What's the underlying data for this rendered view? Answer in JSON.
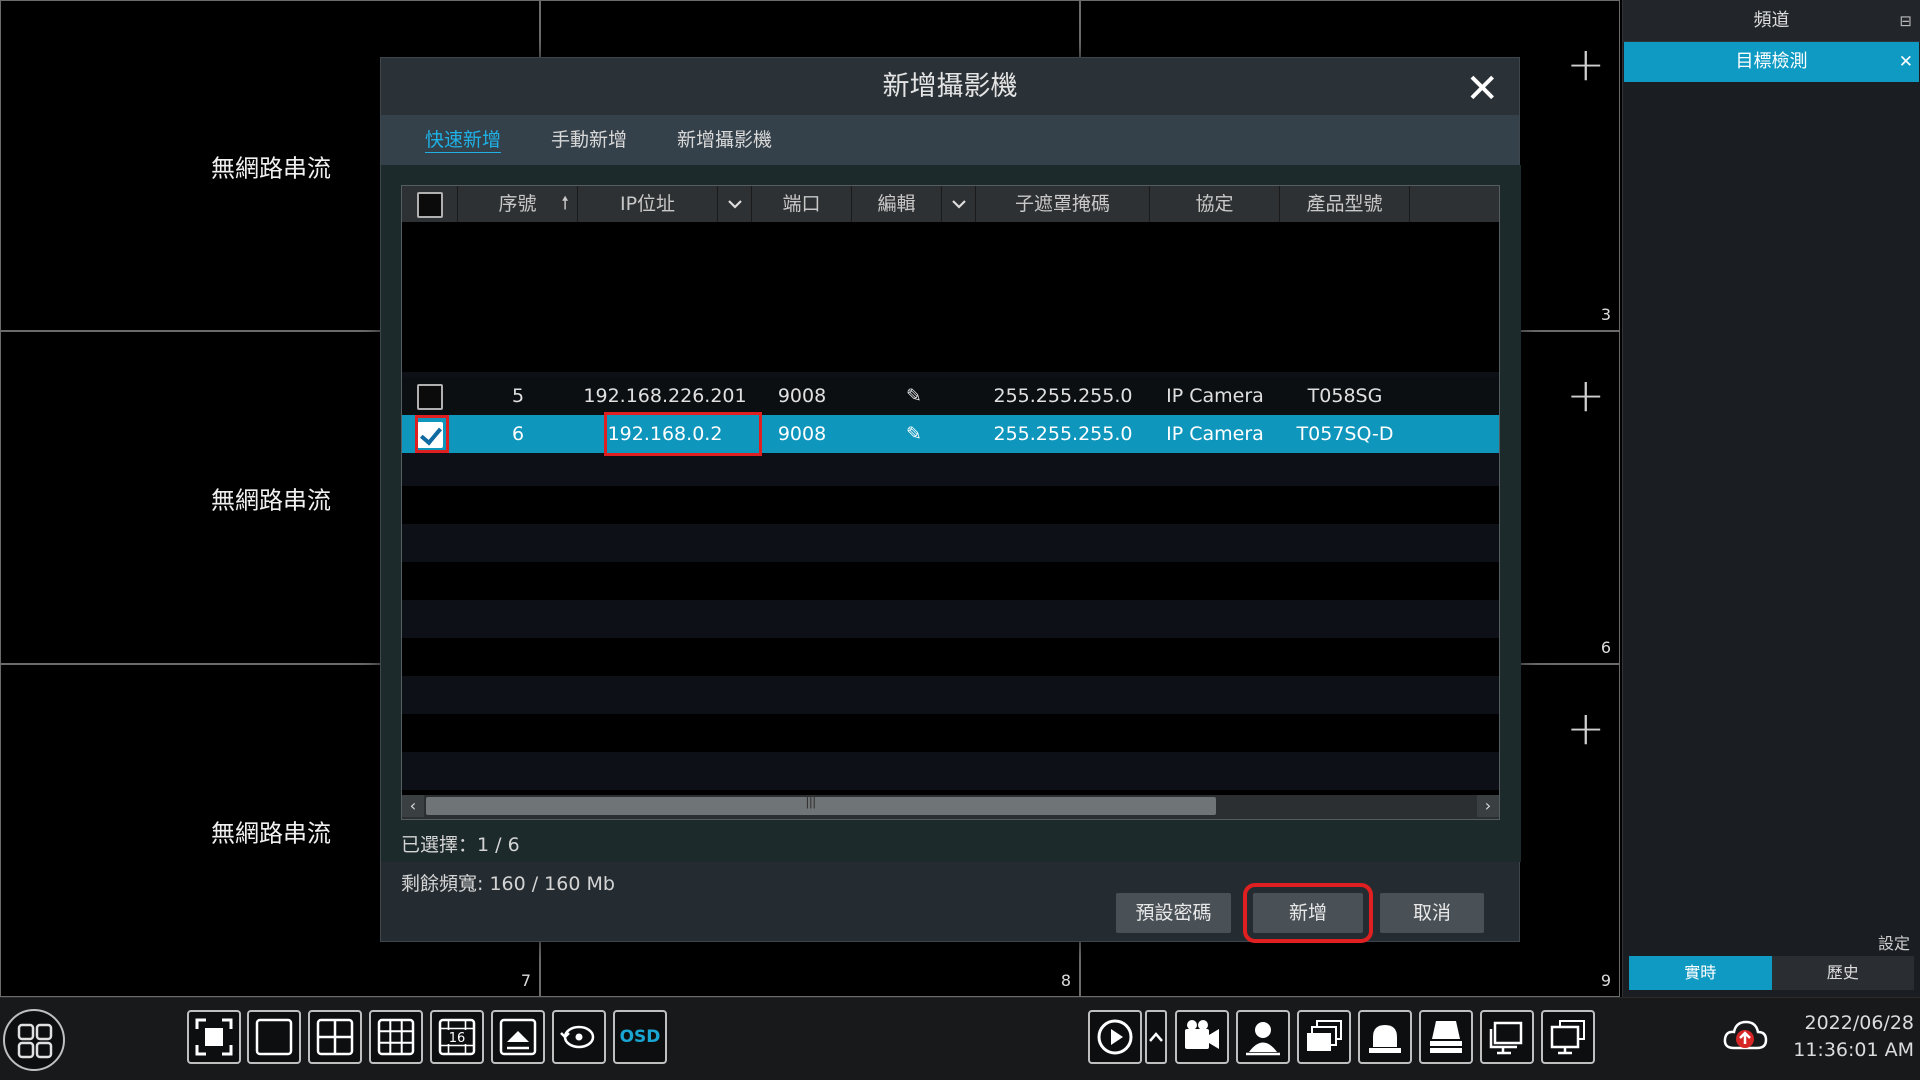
{
  "grid": {
    "no_stream_text": "無網路串流",
    "cell_numbers": [
      "3",
      "6",
      "7",
      "8",
      "9"
    ],
    "add_icon": "plus-icon"
  },
  "side_panel": {
    "header": "頻道",
    "pin_icon": "pin-icon",
    "active_tab": "目標檢測",
    "settings_label": "設定",
    "mode_live": "實時",
    "mode_history": "歷史"
  },
  "dialog": {
    "title": "新增攝影機",
    "tabs": [
      "快速新增",
      "手動新增",
      "新增攝影機"
    ],
    "active_tab_index": 0,
    "columns": [
      "序號",
      "IP位址",
      "端口",
      "編輯",
      "子遮罩掩碼",
      "協定",
      "產品型號"
    ],
    "rows": [
      {
        "checked": false,
        "index": "5",
        "ip": "192.168.226.201",
        "port": "9008",
        "mask": "255.255.255.0",
        "protocol": "IP Camera",
        "model": "T058SG"
      },
      {
        "checked": true,
        "index": "6",
        "ip": "192.168.0.2",
        "port": "9008",
        "mask": "255.255.255.0",
        "protocol": "IP Camera",
        "model": "T057SQ-D"
      }
    ],
    "selected_count": "已選擇：1 / 6",
    "bandwidth": "剩餘頻寬: 160 / 160 Mb",
    "buttons": {
      "default_password": "預設密碼",
      "add": "新增",
      "cancel": "取消"
    },
    "highlight_color": "#e02020",
    "selected_row_color": "#0e96bd"
  },
  "toolbar": {
    "osd_label": "OSD",
    "date": "2022/06/28",
    "time": "11:36:01 AM",
    "grid16_label": "16"
  }
}
